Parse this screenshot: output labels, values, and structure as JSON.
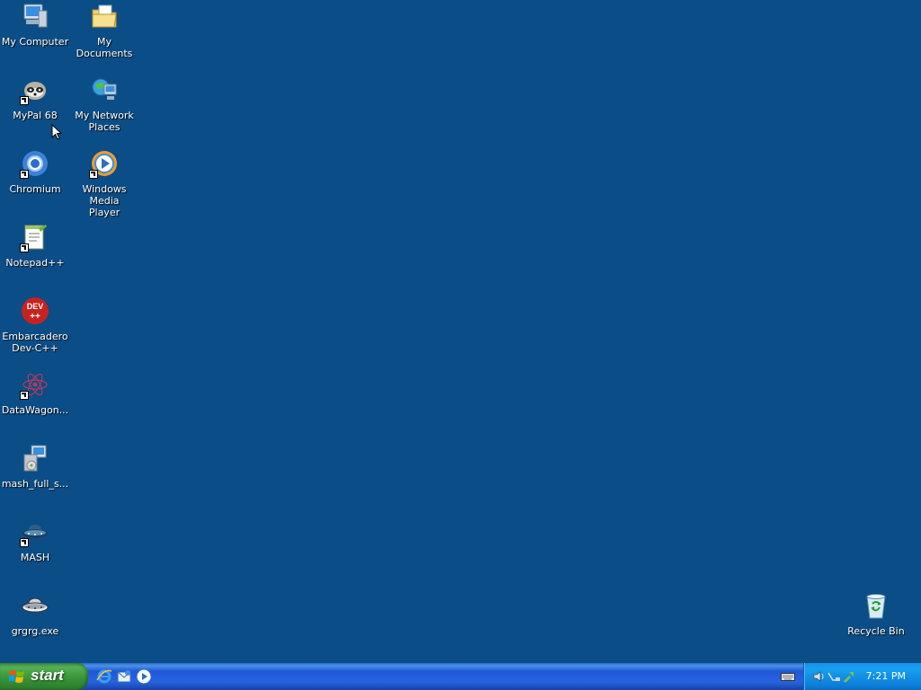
{
  "desktop": {
    "background_color": "#0b4d86",
    "icons": [
      {
        "label": "My Computer",
        "icon": "computer-icon"
      },
      {
        "label": "My Documents",
        "icon": "folder-documents-icon"
      },
      {
        "label": "MyPal 68",
        "icon": "raccoon-browser-icon"
      },
      {
        "label": "My Network\nPlaces",
        "icon": "network-places-icon"
      },
      {
        "label": "Chromium",
        "icon": "chromium-icon"
      },
      {
        "label": "Windows Media\nPlayer",
        "icon": "media-player-icon"
      },
      {
        "label": "Notepad++",
        "icon": "notepadpp-icon"
      },
      {
        "label": "Embarcadero\nDev-C++",
        "icon": "devcpp-icon"
      },
      {
        "label": "DataWagon...",
        "icon": "datawagon-icon"
      },
      {
        "label": "mash_full_s...",
        "icon": "installer-icon"
      },
      {
        "label": "MASH",
        "icon": "ufo-icon"
      },
      {
        "label": "grgrg.exe",
        "icon": "ufo-exe-icon"
      },
      {
        "label": "Recycle Bin",
        "icon": "recycle-bin-icon"
      }
    ]
  },
  "taskbar": {
    "start_label": "start",
    "quick_launch": [
      "internet-explorer-icon",
      "outlook-express-icon",
      "media-player-icon"
    ],
    "tray": {
      "clock": "7:21 PM",
      "icons": [
        "volume-icon",
        "network-icon",
        "safely-remove-icon"
      ]
    },
    "keyboard_icon": "keyboard-icon"
  }
}
